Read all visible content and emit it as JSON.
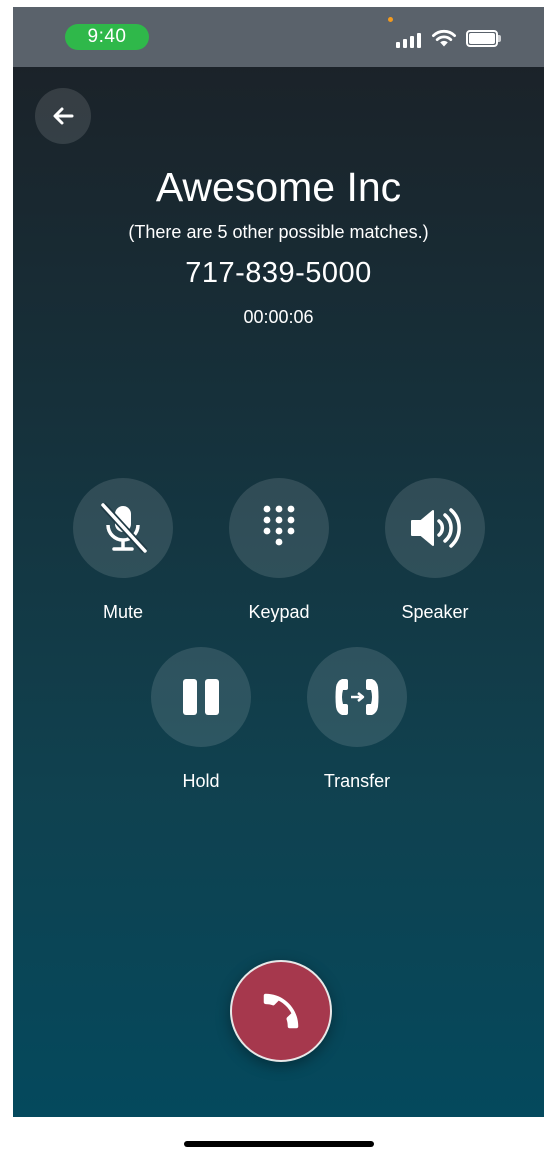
{
  "status_bar": {
    "time": "9:40"
  },
  "back_button": {
    "icon": "arrow-left-icon"
  },
  "call": {
    "contact_name": "Awesome Inc",
    "matches_note": "(There are 5 other possible matches.)",
    "phone_number": "717-839-5000",
    "duration": "00:00:06"
  },
  "controls": [
    {
      "label": "Mute",
      "icon": "mic-off-icon"
    },
    {
      "label": "Keypad",
      "icon": "keypad-icon"
    },
    {
      "label": "Speaker",
      "icon": "speaker-icon"
    },
    {
      "label": "Hold",
      "icon": "pause-icon"
    },
    {
      "label": "Transfer",
      "icon": "transfer-call-icon"
    }
  ],
  "end_call": {
    "icon": "phone-hangup-icon"
  },
  "colors": {
    "status_pill": "#2fb84a",
    "end_call": "#a6384d",
    "background_top": "#1c2026",
    "background_bottom": "#04495d"
  }
}
